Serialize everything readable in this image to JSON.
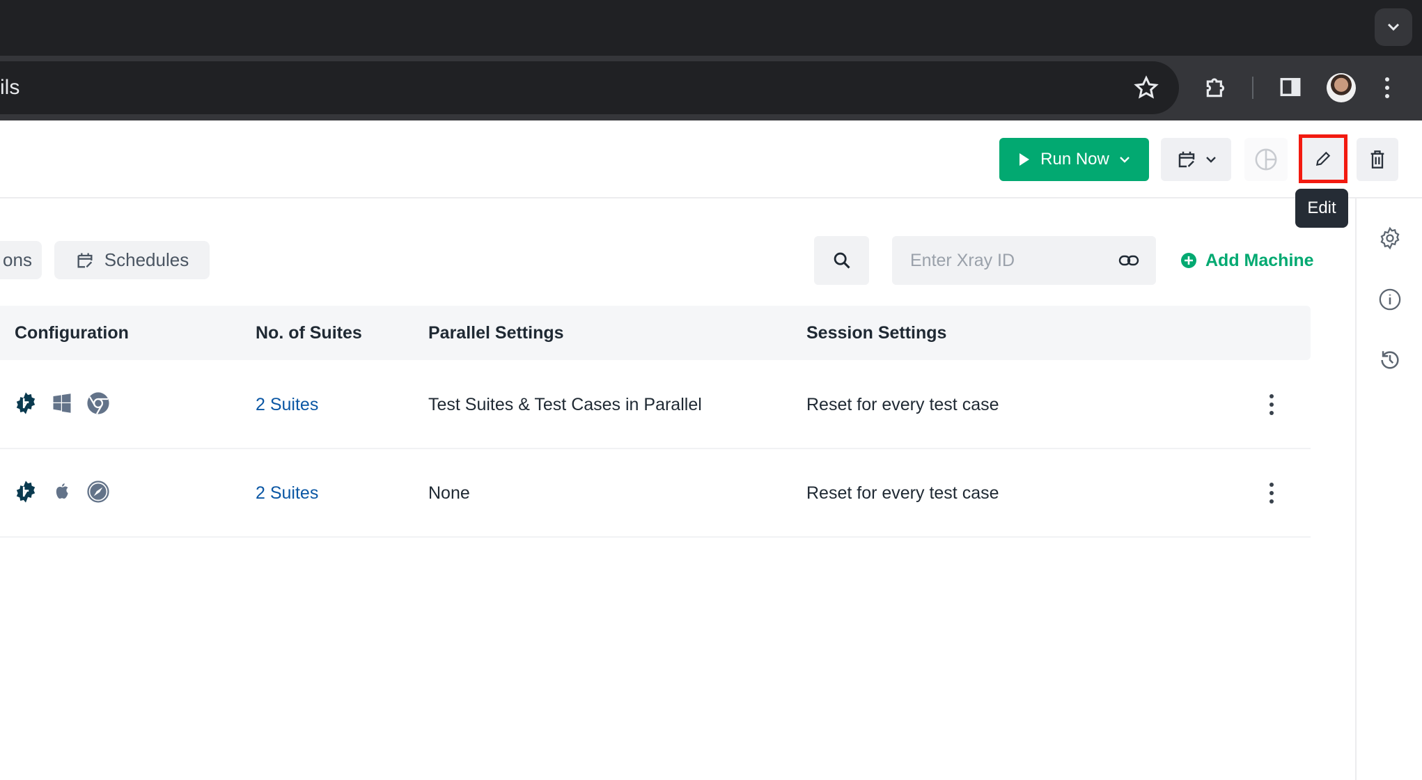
{
  "browser": {
    "address_text": "ils",
    "colors": {
      "frame": "#202124",
      "toolbar": "#35363a"
    }
  },
  "header": {
    "run_now_label": "Run Now",
    "edit_tooltip": "Edit",
    "colors": {
      "primary": "#02a971",
      "highlight": "#f21a10"
    }
  },
  "tabs": [
    {
      "label": "ons"
    },
    {
      "label": "Schedules",
      "icon": "calendar-edit-icon"
    }
  ],
  "toolbar": {
    "xray_placeholder": "Enter Xray ID",
    "add_machine_label": "Add Machine"
  },
  "table": {
    "columns": [
      "Configuration",
      "No. of Suites",
      "Parallel Settings",
      "Session Settings"
    ],
    "rows": [
      {
        "config_icons": [
          "testsigma-gear-icon",
          "windows-icon",
          "chrome-icon"
        ],
        "suites": "2 Suites",
        "parallel": "Test Suites & Test Cases in Parallel",
        "session": "Reset for every test case"
      },
      {
        "config_icons": [
          "testsigma-gear-icon",
          "apple-icon",
          "safari-icon"
        ],
        "suites": "2 Suites",
        "parallel": "None",
        "session": "Reset for every test case"
      }
    ]
  },
  "right_sidebar": {
    "icons": [
      "settings-icon",
      "info-icon",
      "history-icon"
    ]
  }
}
